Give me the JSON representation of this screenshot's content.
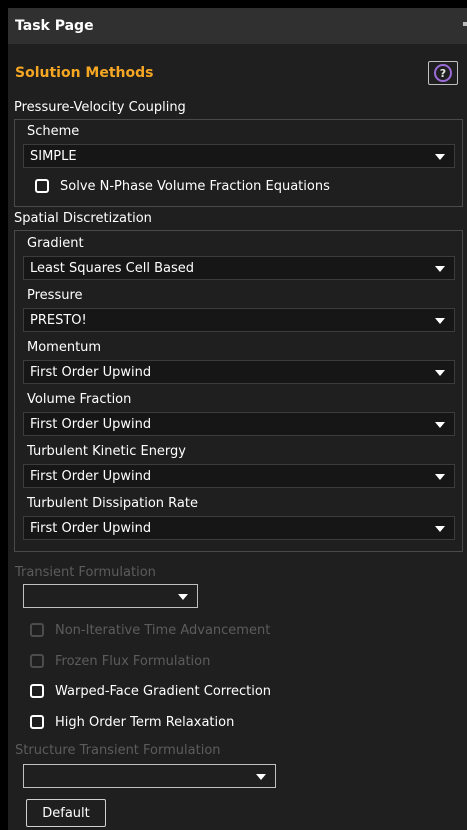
{
  "task_page": {
    "title": "Task Page"
  },
  "solution_methods": {
    "title": "Solution Methods",
    "help_icon": "question-circle-icon",
    "pressure_velocity_coupling": {
      "label": "Pressure-Velocity Coupling",
      "scheme_label": "Scheme",
      "scheme_value": "SIMPLE",
      "solve_nphase_label": "Solve N-Phase Volume Fraction Equations",
      "solve_nphase_checked": false
    },
    "spatial_discretization": {
      "label": "Spatial Discretization",
      "gradient_label": "Gradient",
      "gradient_value": "Least Squares Cell Based",
      "pressure_label": "Pressure",
      "pressure_value": "PRESTO!",
      "momentum_label": "Momentum",
      "momentum_value": "First Order Upwind",
      "volume_fraction_label": "Volume Fraction",
      "volume_fraction_value": "First Order Upwind",
      "tke_label": "Turbulent Kinetic Energy",
      "tke_value": "First Order Upwind",
      "tdr_label": "Turbulent Dissipation Rate",
      "tdr_value": "First Order Upwind"
    },
    "transient_formulation": {
      "label": "Transient Formulation",
      "value": "",
      "enabled": false
    },
    "options": {
      "non_iterative_label": "Non-Iterative Time Advancement",
      "non_iterative_enabled": false,
      "frozen_flux_label": "Frozen Flux Formulation",
      "frozen_flux_enabled": false,
      "warped_face_label": "Warped-Face Gradient Correction",
      "warped_face_checked": false,
      "high_order_label": "High Order Term Relaxation",
      "high_order_checked": false
    },
    "structure_transient_formulation": {
      "label": "Structure Transient Formulation",
      "value": "",
      "enabled": false
    },
    "default_button_label": "Default"
  },
  "colors": {
    "accent": "#f5a623",
    "help_ring": "#9b6bd8",
    "panel_bg": "#1f1f1f",
    "disabled_text": "#5c5c5c"
  }
}
